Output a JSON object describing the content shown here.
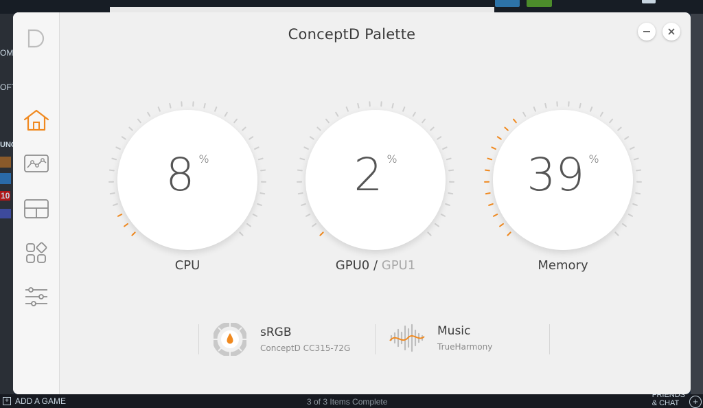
{
  "app": {
    "title": "ConceptD Palette",
    "logo_letter": "D",
    "accent": "#f0891f",
    "icon_color": "#8d8d8d"
  },
  "sidebar": {
    "items": [
      {
        "name": "home",
        "icon": "home-icon",
        "active": true
      },
      {
        "name": "monitoring",
        "icon": "chart-line-icon",
        "active": false
      },
      {
        "name": "layout",
        "icon": "window-layout-icon",
        "active": false
      },
      {
        "name": "apps",
        "icon": "apps-grid-icon",
        "active": false
      },
      {
        "name": "settings",
        "icon": "sliders-icon",
        "active": false
      }
    ]
  },
  "window_controls": {
    "minimize_icon": "minimize-icon",
    "close_icon": "close-icon"
  },
  "gauges": [
    {
      "label": "CPU",
      "value": "8",
      "unit": "%",
      "level": 0.08
    },
    {
      "label": "GPU0",
      "separator": " / ",
      "alt_label": "GPU1",
      "value": "2",
      "unit": "%",
      "level": 0.02
    },
    {
      "label": "Memory",
      "value": "39",
      "unit": "%",
      "level": 0.39
    }
  ],
  "cards": [
    {
      "title": "sRGB",
      "subtitle": "ConceptD CC315-72G",
      "icon": "color-profile-icon"
    },
    {
      "title": "Music",
      "subtitle": "TrueHarmony",
      "icon": "sound-wave-icon"
    }
  ],
  "background": {
    "side_fragments": [
      "OM",
      "OFT",
      "UNG",
      "10"
    ],
    "bottom": {
      "add_game": "ADD A GAME",
      "downloads": "3 of 3 Items Complete",
      "friends_line1": "FRIENDS",
      "friends_line2": "& CHAT"
    }
  }
}
